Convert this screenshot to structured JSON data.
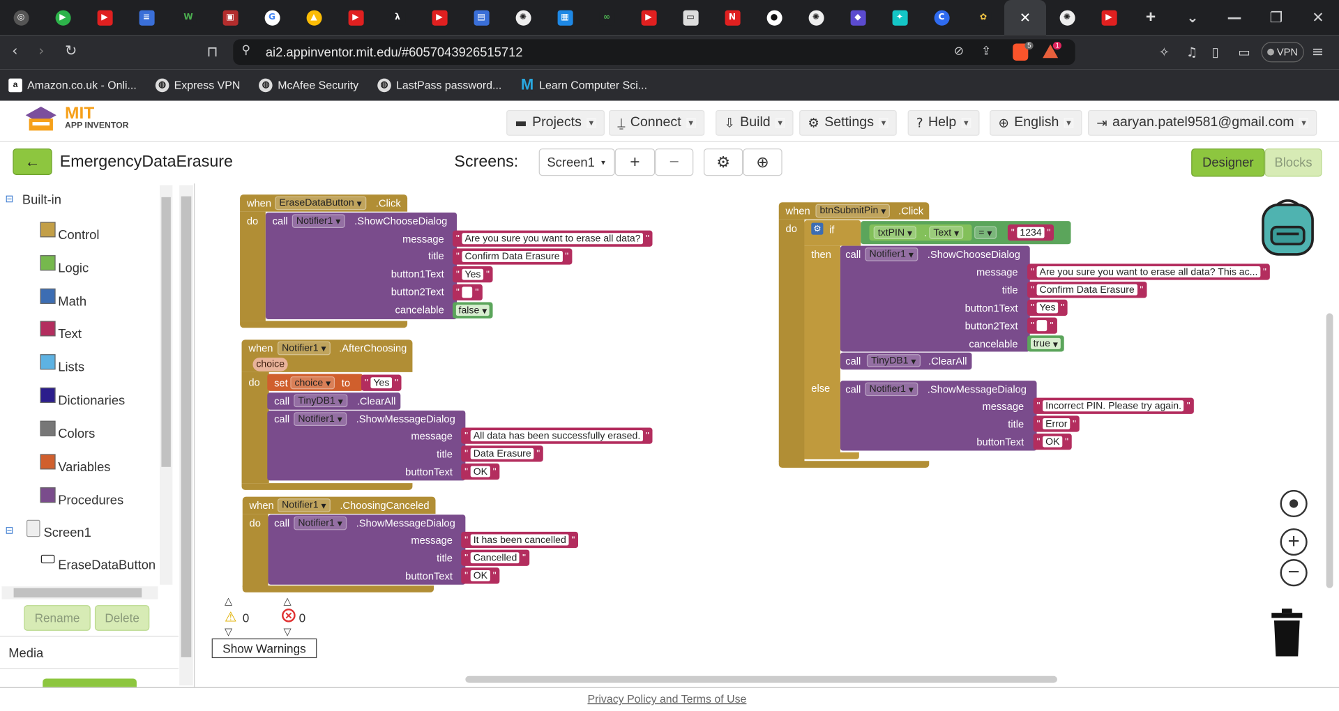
{
  "browser": {
    "url": "ai2.appinventor.mit.edu/#6057043926515712",
    "vpn": "VPN",
    "shield_count": "5",
    "alert_count": "1"
  },
  "bookmarks": [
    "Amazon.co.uk - Onli...",
    "Express VPN",
    "McAfee Security",
    "LastPass password...",
    "Learn Computer Sci..."
  ],
  "header": {
    "logo_top": "MIT",
    "logo_bottom": "APP INVENTOR",
    "projects": "Projects",
    "connect": "Connect",
    "build": "Build",
    "settings": "Settings",
    "help": "Help",
    "language": "English",
    "account": "aaryan.patel9581@gmail.com"
  },
  "project": {
    "name": "EmergencyDataErasure",
    "screens_label": "Screens:",
    "screen": "Screen1",
    "add": "+",
    "remove": "−",
    "designer": "Designer",
    "blocks": "Blocks"
  },
  "tree": {
    "builtin": "Built-in",
    "items": [
      "Control",
      "Logic",
      "Math",
      "Text",
      "Lists",
      "Dictionaries",
      "Colors",
      "Variables",
      "Procedures"
    ],
    "screen": "Screen1",
    "component": "EraseDataButton",
    "rename": "Rename",
    "delete": "Delete",
    "media": "Media"
  },
  "colors": {
    "Control": "#c39f47",
    "Logic": "#76b84d",
    "Math": "#3c6db3",
    "Text": "#b32d5e",
    "Lists": "#5db2e3",
    "Dictionaries": "#2b1d8c",
    "Colors": "#777777",
    "Variables": "#d05f2d",
    "Procedures": "#7a4c8c"
  },
  "blocks": {
    "when": "when",
    "do": "do",
    "call": "call",
    "then": "then",
    "else": "else",
    "if": "if",
    "set": "set",
    "to": "to",
    "b1": {
      "component": "EraseDataButton",
      "event": ".Click",
      "target": "Notifier1",
      "method": ".ShowChooseDialog",
      "labels": [
        "message",
        "title",
        "button1Text",
        "button2Text",
        "cancelable"
      ],
      "message": "Are you sure you want to erase all data?",
      "title": "Confirm Data Erasure",
      "button1": "Yes",
      "button2": "",
      "cancelable": "false"
    },
    "b2": {
      "component": "Notifier1",
      "event": ".AfterChoosing",
      "param": "choice",
      "var": "choice",
      "value": "Yes",
      "db": "TinyDB1",
      "clear": ".ClearAll",
      "method": ".ShowMessageDialog",
      "labels": [
        "message",
        "title",
        "buttonText"
      ],
      "message": "All data has been successfully erased.",
      "title": "Data Erasure",
      "button": "OK"
    },
    "b3": {
      "component": "Notifier1",
      "event": ".ChoosingCanceled",
      "method": ".ShowMessageDialog",
      "message": "It has been cancelled",
      "title": "Cancelled",
      "button": "OK"
    },
    "b4": {
      "component": "btnSubmitPin",
      "event": ".Click",
      "txt": "txtPIN",
      "prop": "Text",
      "op": "=",
      "pin": "1234",
      "message": "Are you sure you want to erase all data? This ac...",
      "title": "Confirm Data Erasure",
      "button1": "Yes",
      "button2": "",
      "cancelable": "true",
      "db": "TinyDB1",
      "clear": ".ClearAll",
      "else_message": "Incorrect PIN. Please try again.",
      "else_title": "Error",
      "else_button": "OK"
    }
  },
  "warnings": {
    "warn_count": "0",
    "err_count": "0",
    "show": "Show Warnings"
  },
  "footer": "Privacy Policy and Terms of Use"
}
